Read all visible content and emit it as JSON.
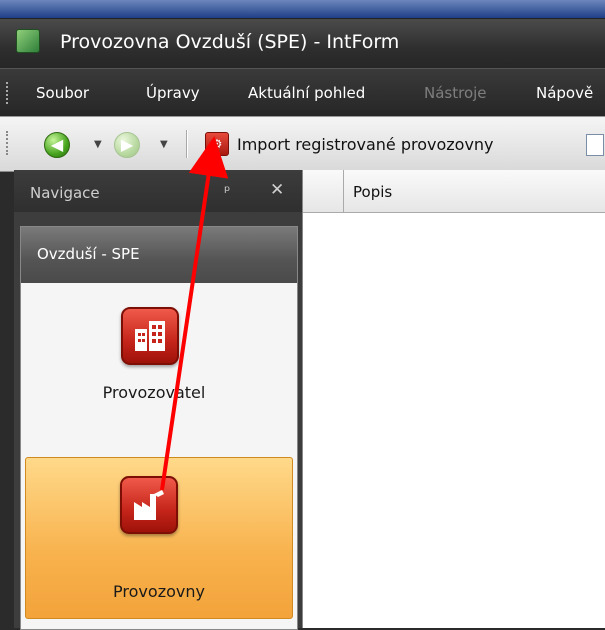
{
  "window": {
    "title": "Provozovna Ovzduší (SPE) - IntForm"
  },
  "menu": {
    "items": [
      {
        "label": "Soubor",
        "enabled": true
      },
      {
        "label": "Úpravy",
        "enabled": true
      },
      {
        "label": "Aktuální pohled",
        "enabled": true
      },
      {
        "label": "Nástroje",
        "enabled": false
      },
      {
        "label": "Nápově",
        "enabled": true
      }
    ]
  },
  "toolbar": {
    "back_icon": "back-arrow-icon",
    "forward_icon": "forward-arrow-icon",
    "import_label": "Import registrované provozovny"
  },
  "navigation": {
    "title": "Navigace",
    "group": "Ovzduší - SPE",
    "items": [
      {
        "label": "Provozovatel",
        "icon": "building-icon",
        "selected": false
      },
      {
        "label": "Provozovny",
        "icon": "factory-icon",
        "selected": true
      }
    ]
  },
  "grid": {
    "columns": [
      "Popis"
    ]
  },
  "colors": {
    "selected": "#f8b24d",
    "accent_red": "#c5251a",
    "annotation_arrow": "#ff0000"
  }
}
